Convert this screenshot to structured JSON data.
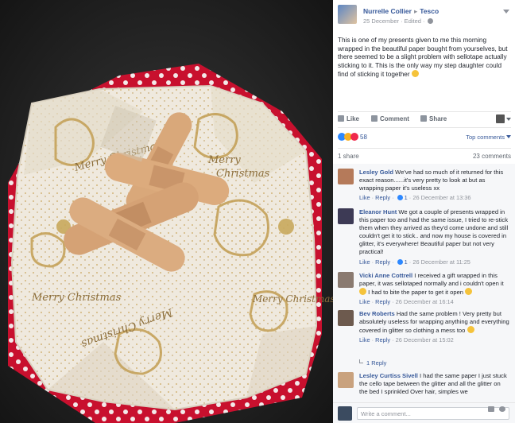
{
  "post": {
    "author": "Nurrelle Collier",
    "arrow": "▸",
    "target": "Tesco",
    "meta": "25 December · Edited ·",
    "text": "This is one of my presents given to me this morning wrapped in the beautiful paper bought from yourselves, but there seemed to be a slight problem with sellotape actually sticking to it. This is the only way my step daughter could find of sticking it together",
    "actions": {
      "like": "Like",
      "comment": "Comment",
      "share": "Share"
    },
    "reaction_count": "58",
    "top_comments": "Top comments",
    "shares": "1 share",
    "comment_count": "23 comments"
  },
  "photo": {
    "paper_text_1": "Merry Christmas",
    "paper_text_2": "Merry",
    "paper_text_3": "Christmas",
    "paper_text_4": "Merry Christmas"
  },
  "comments": [
    {
      "name": "Lesley Gold",
      "text": "We've had so much of it returned for this exact reason......it's very pretty to look at but as wrapping paper it's useless xx",
      "like": "Like",
      "reply": "Reply",
      "likes": "1",
      "time": "26 December at 13:36"
    },
    {
      "name": "Eleanor Hunt",
      "text": "We got a couple of presents wrapped in this paper too and had the same issue, I tried to re-stick them when they arrived as they'd come undone and still couldn't get it to stick.. and now my house is covered in glitter, it's everywhere! Beautiful paper but not very practical!",
      "like": "Like",
      "reply": "Reply",
      "likes": "1",
      "time": "26 December at 11:25"
    },
    {
      "name": "Vicki Anne Cottrell",
      "text": "I received a gift wrapped in this paper, it was sellotaped normally and i couldn't open it",
      "text2": "I had to bite the paper to get it open",
      "like": "Like",
      "reply": "Reply",
      "time": "26 December at 16:14"
    },
    {
      "name": "Bev Roberts",
      "text": "Had the same problem ! Very pretty but absolutely useless for wrapping anything and everything covered in glitter so clothing a mess too",
      "like": "Like",
      "reply": "Reply",
      "time": "26 December at 15:02",
      "replies": "1 Reply"
    },
    {
      "name": "Lesley Curtiss Sivell",
      "text": "I had the same paper I just stuck the cello tape between the glitter and all the glitter on the bed I sprinkled Over hair, simples we"
    }
  ],
  "composer": {
    "placeholder": "Write a comment..."
  },
  "colors": {
    "fb_blue": "#365899",
    "meta_gray": "#90949c",
    "text": "#1d2129"
  }
}
